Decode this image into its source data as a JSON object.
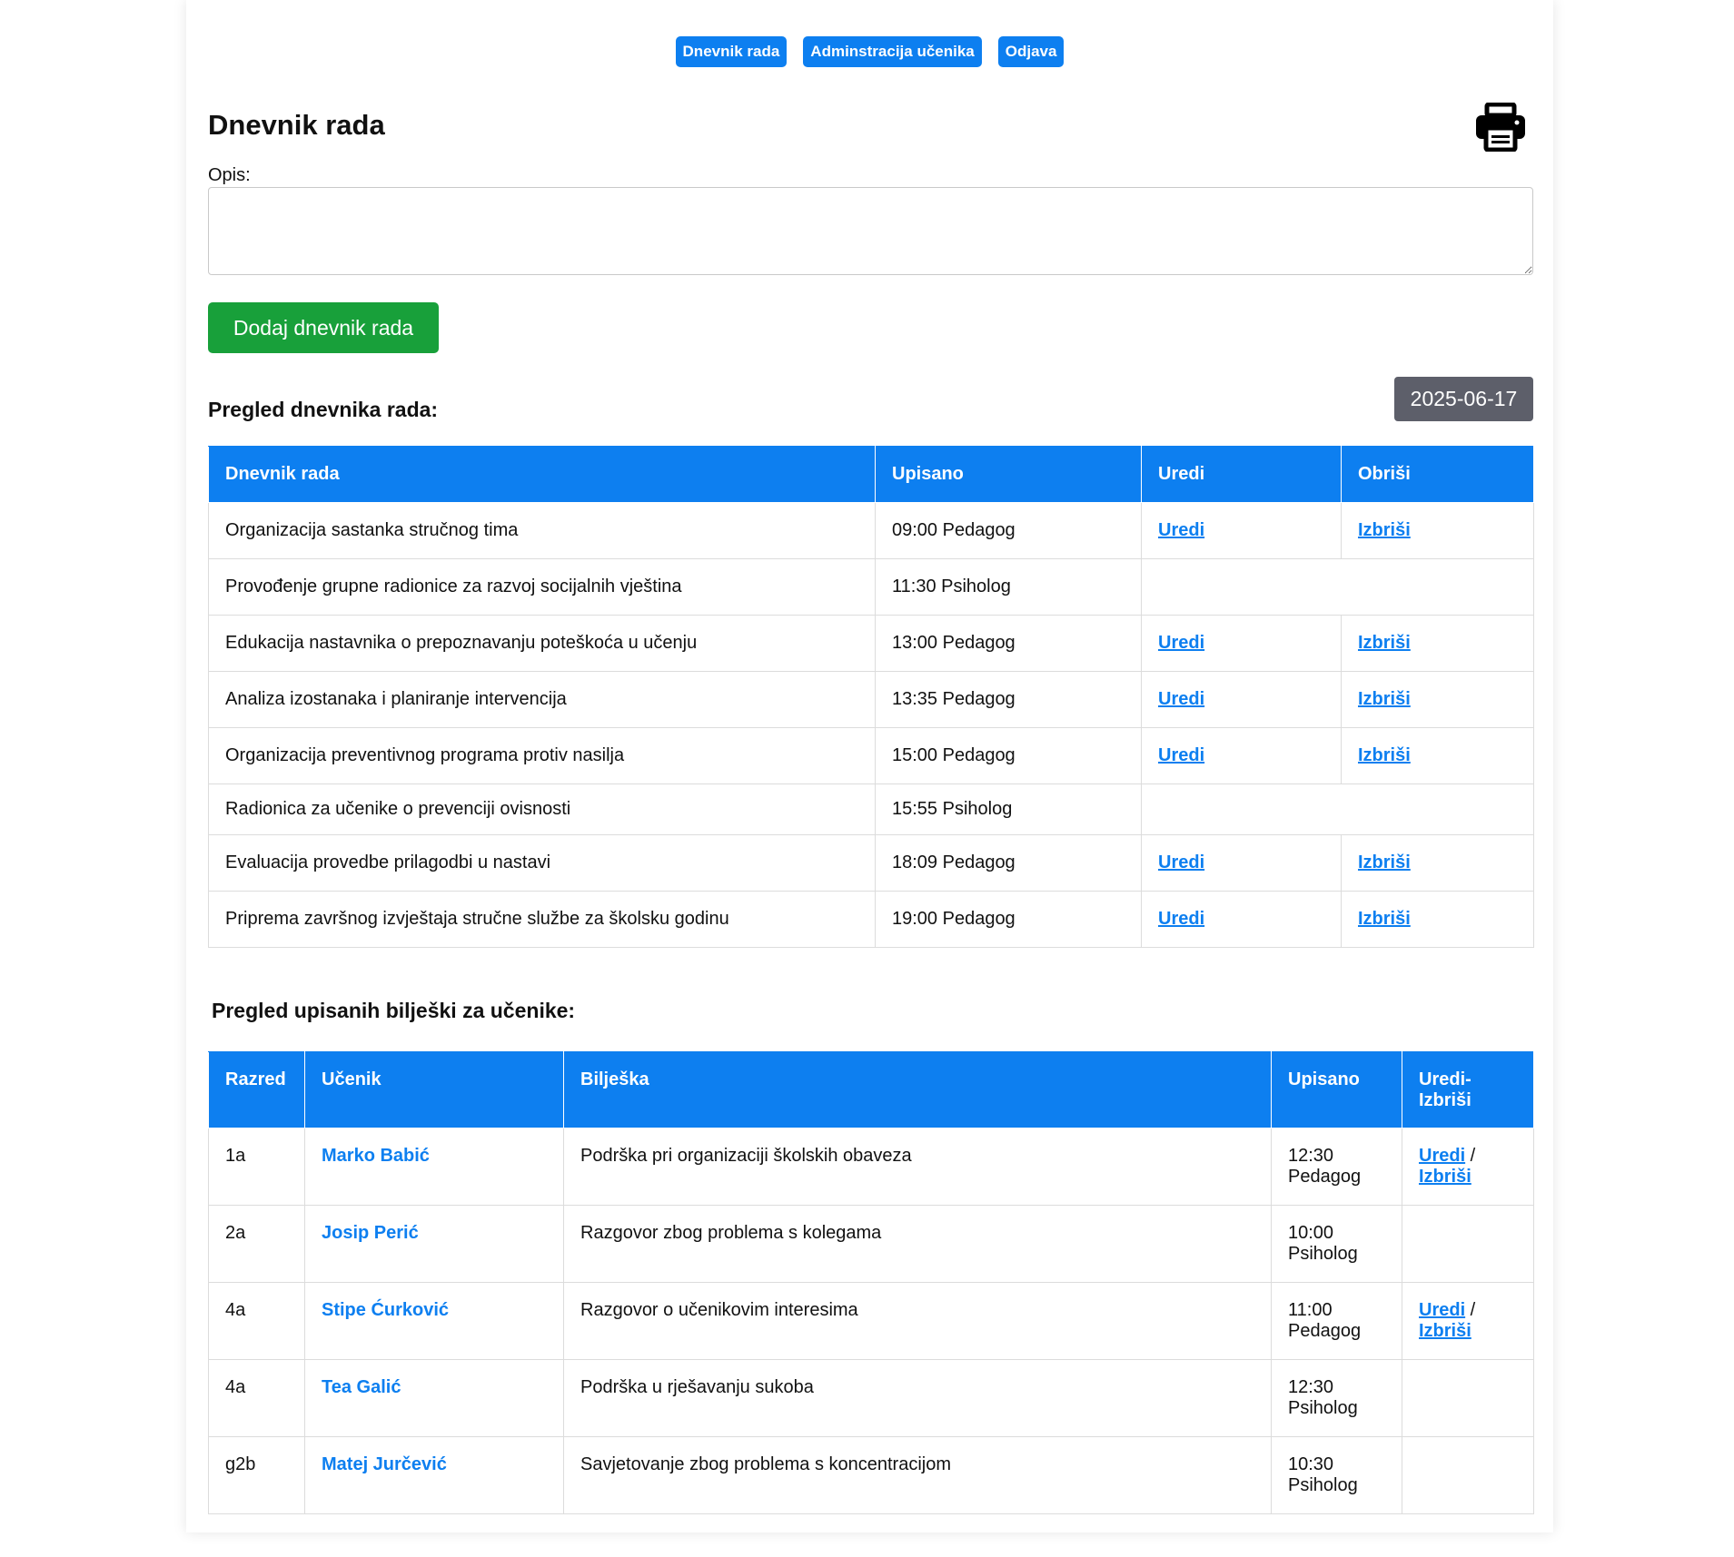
{
  "nav": {
    "items": [
      "Dnevnik rada",
      "Adminstracija učenika",
      "Odjava"
    ]
  },
  "page": {
    "title": "Dnevnik rada",
    "print_icon": "printer-icon"
  },
  "form": {
    "opis_label": "Opis:",
    "opis_value": "",
    "add_button": "Dodaj dnevnik rada"
  },
  "journal": {
    "heading": "Pregled dnevnika rada:",
    "date": "2025-06-17",
    "headers": [
      "Dnevnik rada",
      "Upisano",
      "Uredi",
      "Obriši"
    ],
    "rows": [
      {
        "text": "Organizacija sastanka stručnog tima",
        "upisano": "09:00 Pedagog",
        "edit": "Uredi",
        "delete": "Izbriši"
      },
      {
        "text": "Provođenje grupne radionice za razvoj socijalnih vještina",
        "upisano": "11:30 Psiholog",
        "edit": "",
        "delete": ""
      },
      {
        "text": "Edukacija nastavnika o prepoznavanju poteškoća u učenju",
        "upisano": "13:00 Pedagog",
        "edit": "Uredi",
        "delete": "Izbriši"
      },
      {
        "text": "Analiza izostanaka i planiranje intervencija",
        "upisano": "13:35 Pedagog",
        "edit": "Uredi",
        "delete": "Izbriši"
      },
      {
        "text": "Organizacija preventivnog programa protiv nasilja",
        "upisano": "15:00 Pedagog",
        "edit": "Uredi",
        "delete": "Izbriši"
      },
      {
        "text": "Radionica za učenike o prevenciji ovisnosti",
        "upisano": "15:55 Psiholog",
        "edit": "",
        "delete": ""
      },
      {
        "text": "Evaluacija provedbe prilagodbi u nastavi",
        "upisano": "18:09 Pedagog",
        "edit": "Uredi",
        "delete": "Izbriši"
      },
      {
        "text": "Priprema završnog izvještaja stručne službe za školsku godinu",
        "upisano": "19:00 Pedagog",
        "edit": "Uredi",
        "delete": "Izbriši"
      }
    ]
  },
  "notes": {
    "heading": "Pregled upisanih bilješki za učenike:",
    "headers": {
      "razred": "Razred",
      "ucenik": "Učenik",
      "biljeska": "Bilješka",
      "upisano": "Upisano",
      "actions_line1": "Uredi-",
      "actions_line2": "Izbriši"
    },
    "separator": " /",
    "rows": [
      {
        "razred": "1a",
        "ucenik": "Marko Babić",
        "biljeska": "Podrška pri organizaciji školskih obaveza",
        "time": "12:30",
        "role": "Pedagog",
        "edit": "Uredi",
        "delete": "Izbriši"
      },
      {
        "razred": "2a",
        "ucenik": "Josip Perić",
        "biljeska": "Razgovor zbog problema s kolegama",
        "time": "10:00",
        "role": "Psiholog",
        "edit": "",
        "delete": ""
      },
      {
        "razred": "4a",
        "ucenik": "Stipe Ćurković",
        "biljeska": "Razgovor o učenikovim interesima",
        "time": "11:00",
        "role": "Pedagog",
        "edit": "Uredi",
        "delete": "Izbriši"
      },
      {
        "razred": "4a",
        "ucenik": "Tea Galić",
        "biljeska": "Podrška u rješavanju sukoba",
        "time": "12:30",
        "role": "Psiholog",
        "edit": "",
        "delete": ""
      },
      {
        "razred": "g2b",
        "ucenik": "Matej Jurčević",
        "biljeska": "Savjetovanje zbog problema s koncentracijom",
        "time": "10:30",
        "role": "Psiholog",
        "edit": "",
        "delete": ""
      }
    ]
  },
  "colors": {
    "primary": "#0d7ff0",
    "success": "#18a03a",
    "date_badge": "#5d5f6a"
  }
}
